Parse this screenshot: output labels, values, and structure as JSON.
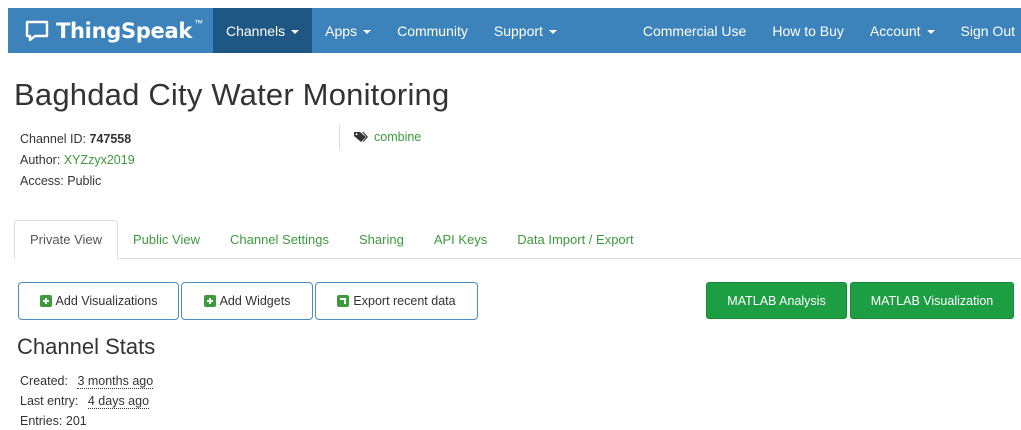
{
  "navbar": {
    "brand": "ThingSpeak",
    "brand_tm": "™",
    "items": [
      {
        "label": "Channels"
      },
      {
        "label": "Apps"
      },
      {
        "label": "Community"
      },
      {
        "label": "Support"
      }
    ],
    "right_items": [
      {
        "label": "Commercial Use"
      },
      {
        "label": "How to Buy"
      },
      {
        "label": "Account"
      },
      {
        "label": "Sign Out"
      }
    ]
  },
  "channel": {
    "title": "Baghdad City Water Monitoring",
    "id_label": "Channel ID:",
    "id": "747558",
    "author_label": "Author:",
    "author": "XYZzyx2019",
    "access_label": "Access:",
    "access": "Public",
    "tag": "combine"
  },
  "tabs": [
    {
      "label": "Private View"
    },
    {
      "label": "Public View"
    },
    {
      "label": "Channel Settings"
    },
    {
      "label": "Sharing"
    },
    {
      "label": "API Keys"
    },
    {
      "label": "Data Import / Export"
    }
  ],
  "actions": {
    "add_visualizations": "Add Visualizations",
    "add_widgets": "Add Widgets",
    "export_recent": "Export recent data",
    "matlab_analysis": "MATLAB Analysis",
    "matlab_visualization": "MATLAB Visualization"
  },
  "stats": {
    "title": "Channel Stats",
    "created_label": "Created:",
    "created": "3 months ago",
    "last_entry_label": "Last entry:",
    "last_entry": "4 days ago",
    "entries_label": "Entries:",
    "entries": "201"
  },
  "colors": {
    "navbar": "#3c83bc",
    "navbar_active": "#1f5784",
    "link_green": "#3d9a3d",
    "matlab_green": "#1e9e43"
  }
}
